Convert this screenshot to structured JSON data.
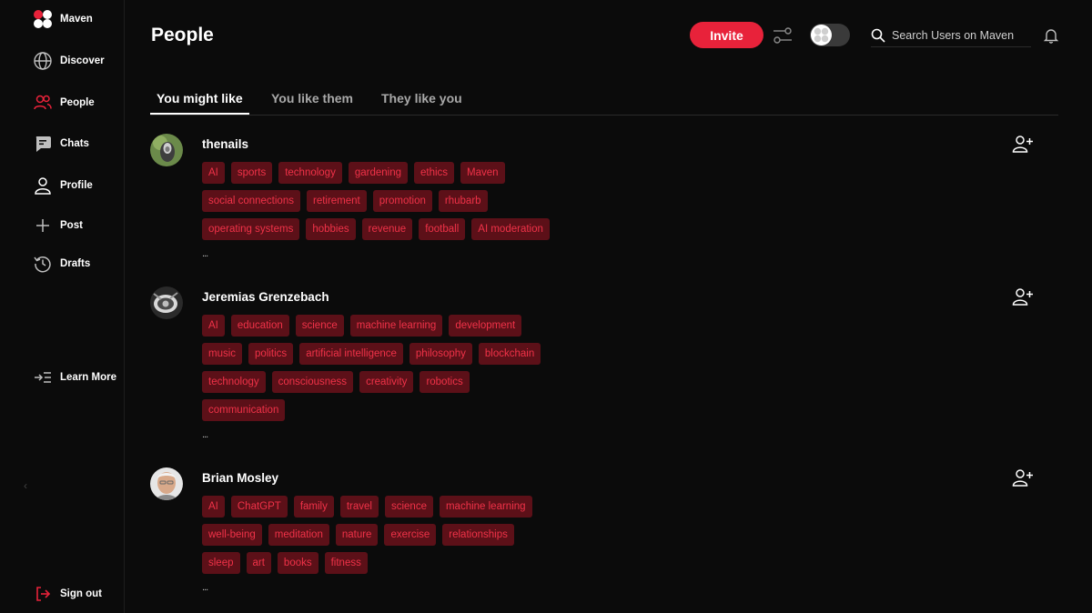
{
  "sidebar": {
    "items": [
      {
        "label": "Maven",
        "icon": "maven-logo-icon"
      },
      {
        "label": "Discover",
        "icon": "globe-icon"
      },
      {
        "label": "People",
        "icon": "people-icon"
      },
      {
        "label": "Chats",
        "icon": "chat-icon"
      },
      {
        "label": "Profile",
        "icon": "user-icon"
      },
      {
        "label": "Post",
        "icon": "plus-icon"
      },
      {
        "label": "Drafts",
        "icon": "history-icon"
      }
    ],
    "learn_more": "Learn More",
    "sign_out": "Sign out"
  },
  "header": {
    "title": "People",
    "invite_label": "Invite",
    "search_placeholder": "Search Users on Maven"
  },
  "tabs": [
    {
      "label": "You might like",
      "active": true
    },
    {
      "label": "You like them",
      "active": false
    },
    {
      "label": "They like you",
      "active": false
    }
  ],
  "people": [
    {
      "name": "thenails",
      "tags": [
        [
          "AI",
          "sports",
          "technology",
          "gardening",
          "ethics",
          "Maven"
        ],
        [
          "social connections",
          "retirement",
          "promotion",
          "rhubarb"
        ],
        [
          "operating systems",
          "hobbies",
          "revenue",
          "football",
          "AI moderation"
        ]
      ],
      "more": "..."
    },
    {
      "name": "Jeremias Grenzebach",
      "tags": [
        [
          "AI",
          "education",
          "science",
          "machine learning",
          "development"
        ],
        [
          "music",
          "politics",
          "artificial intelligence",
          "philosophy",
          "blockchain"
        ],
        [
          "technology",
          "consciousness",
          "creativity",
          "robotics"
        ],
        [
          "communication"
        ]
      ],
      "more": "..."
    },
    {
      "name": "Brian Mosley",
      "tags": [
        [
          "AI",
          "ChatGPT",
          "family",
          "travel",
          "science",
          "machine learning"
        ],
        [
          "well-being",
          "meditation",
          "nature",
          "exercise",
          "relationships"
        ],
        [
          "sleep",
          "art",
          "books",
          "fitness"
        ]
      ],
      "more": "..."
    }
  ],
  "colors": {
    "accent": "#e8223a",
    "tag_bg": "#5c1018",
    "tag_text": "#f03248",
    "background": "#0b0b0b"
  }
}
